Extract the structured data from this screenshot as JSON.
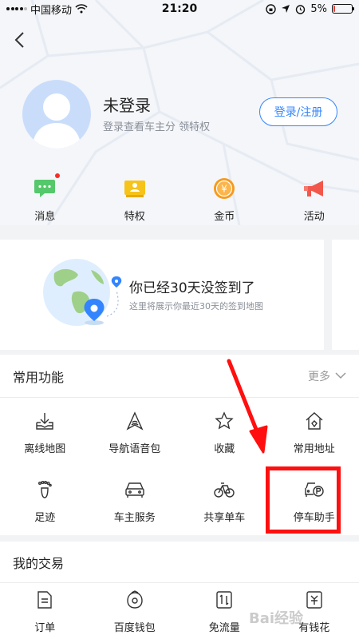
{
  "status_bar": {
    "carrier": "中国移动",
    "time": "21:20",
    "battery": "5%"
  },
  "profile": {
    "name": "未登录",
    "subtitle": "登录查看车主分 领特权",
    "login_label": "登录/注册"
  },
  "quick_items": [
    {
      "label": "消息",
      "icon": "message-icon",
      "color": "#55c86b"
    },
    {
      "label": "特权",
      "icon": "privilege-icon",
      "color": "#f6c31a"
    },
    {
      "label": "金币",
      "icon": "coin-icon",
      "color": "#f79a1c"
    },
    {
      "label": "活动",
      "icon": "megaphone-icon",
      "color": "#f2574b"
    }
  ],
  "signin": {
    "title": "你已经30天没签到了",
    "subtitle": "这里将展示你最近30天的签到地图"
  },
  "common": {
    "title": "常用功能",
    "more": "更多",
    "items": [
      {
        "label": "离线地图",
        "icon": "offline-map-icon"
      },
      {
        "label": "导航语音包",
        "icon": "voice-pack-icon"
      },
      {
        "label": "收藏",
        "icon": "star-icon"
      },
      {
        "label": "常用地址",
        "icon": "home-address-icon"
      },
      {
        "label": "足迹",
        "icon": "footprint-icon"
      },
      {
        "label": "车主服务",
        "icon": "car-icon"
      },
      {
        "label": "共享单车",
        "icon": "bike-icon"
      },
      {
        "label": "停车助手",
        "icon": "parking-icon"
      }
    ]
  },
  "trade": {
    "title": "我的交易",
    "items": [
      {
        "label": "订单",
        "icon": "order-icon"
      },
      {
        "label": "百度钱包",
        "icon": "wallet-icon"
      },
      {
        "label": "免流量",
        "icon": "data-icon"
      },
      {
        "label": "有钱花",
        "icon": "money-icon"
      }
    ]
  },
  "watermark": "Bai经验",
  "colors": {
    "accent": "#3385ff",
    "highlight": "#ff0f0f",
    "red_dot": "#f2302b"
  }
}
